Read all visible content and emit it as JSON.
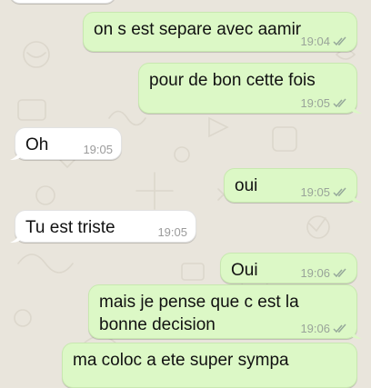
{
  "chat": {
    "messages": [
      {
        "direction": "out",
        "text": "on s est separe avec aamir",
        "time": "19:04",
        "status_icon": "double-check-icon"
      },
      {
        "direction": "out",
        "text": "pour de bon cette fois",
        "time": "19:05",
        "status_icon": "double-check-icon"
      },
      {
        "direction": "in",
        "text": "Oh",
        "time": "19:05"
      },
      {
        "direction": "out",
        "text": "oui",
        "time": "19:05",
        "status_icon": "double-check-icon"
      },
      {
        "direction": "in",
        "text": "Tu est triste",
        "time": "19:05"
      },
      {
        "direction": "out",
        "text": "Oui",
        "time": "19:06",
        "status_icon": "double-check-icon"
      },
      {
        "direction": "out",
        "text": "mais je pense que c est la bonne decision",
        "time": "19:06",
        "status_icon": "double-check-icon"
      },
      {
        "direction": "out",
        "text": "ma coloc a ete super sympa"
      }
    ]
  },
  "colors": {
    "outgoing_bubble": "#dcf8c6",
    "incoming_bubble": "#ffffff",
    "wallpaper": "#e9e5dc"
  }
}
